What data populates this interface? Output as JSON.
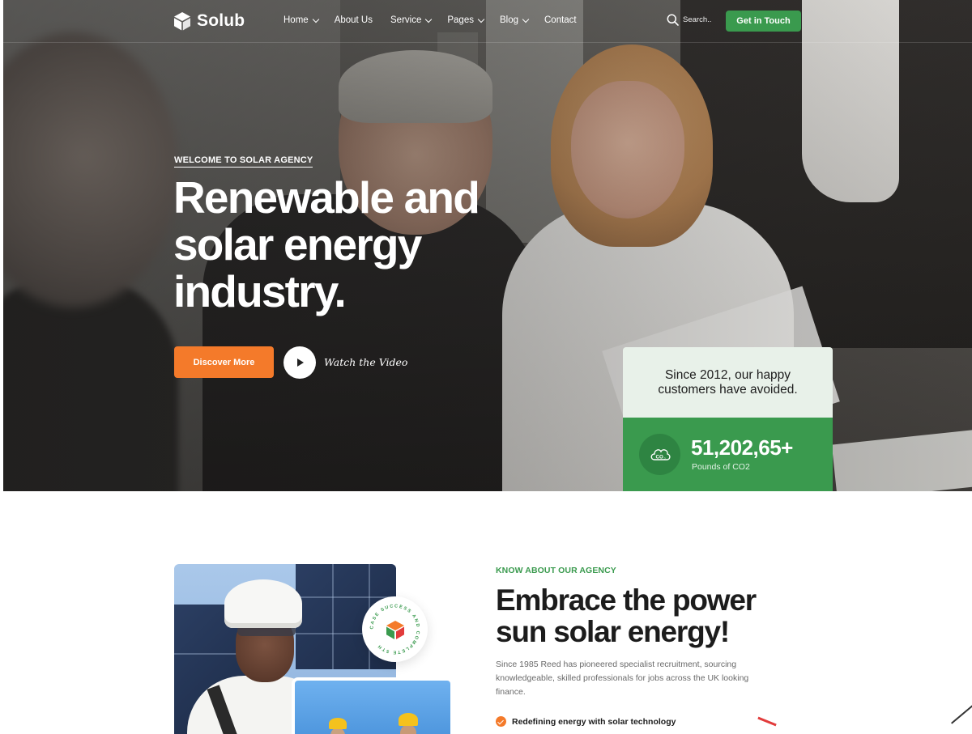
{
  "nav": {
    "logo": "Solub",
    "menu": [
      {
        "label": "Home",
        "dropdown": true
      },
      {
        "label": "About Us",
        "dropdown": false
      },
      {
        "label": "Service",
        "dropdown": true
      },
      {
        "label": "Pages",
        "dropdown": true
      },
      {
        "label": "Blog",
        "dropdown": true
      },
      {
        "label": "Contact",
        "dropdown": false
      }
    ],
    "search_placeholder": "Search..",
    "cta": "Get in Touch"
  },
  "hero": {
    "eyebrow": "WELCOME TO SOLAR AGENCY",
    "title_lines": [
      "Renewable and",
      "solar energy",
      "industry."
    ],
    "primary_button": "Discover More",
    "video_link": "Watch the Video"
  },
  "stats_card": {
    "headline": "Since 2012, our happy customers have avoided.",
    "value": "51,202,65+",
    "unit": "Pounds of CO2",
    "icon": "co2-icon"
  },
  "about": {
    "eyebrow": "KNOW ABOUT OUR AGENCY",
    "title_lines": [
      "Embrace the power",
      "sun solar energy!"
    ],
    "description": "Since 1985 Reed has pioneered specialist recruitment, sourcing knowledgeable, skilled professionals for jobs across the UK looking finance.",
    "badge_text": "CASE SUCCESS AND COMPLETE 5TH",
    "features": [
      "Redefining energy with solar technology"
    ]
  },
  "colors": {
    "accent_green": "#3a9a4e",
    "accent_orange": "#f47a2a",
    "stats_light_bg": "#e8f1e9"
  }
}
